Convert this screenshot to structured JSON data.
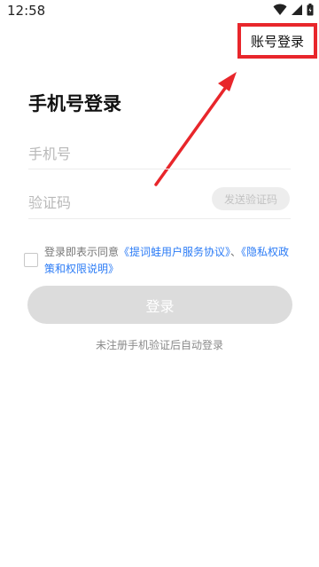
{
  "status_bar": {
    "time": "12:58",
    "icons": [
      "wifi-icon",
      "signal-icon",
      "battery-icon"
    ]
  },
  "header": {
    "account_login_label": "账号登录",
    "highlight_color": "#e8262b"
  },
  "main": {
    "title": "手机号登录",
    "phone_placeholder": "手机号",
    "code_placeholder": "验证码",
    "send_code_label": "发送验证码",
    "agreement": {
      "prefix": "登录即表示同意",
      "link_terms": "《提词蛙用户服务协议》",
      "separator": "、",
      "link_privacy": "《隐私权政策和权限说明》"
    },
    "login_button_label": "登录",
    "hint": "未注册手机验证后自动登录"
  },
  "colors": {
    "link": "#2c7cf6",
    "button_disabled": "#dcdcdc",
    "annotation": "#e8262b"
  }
}
